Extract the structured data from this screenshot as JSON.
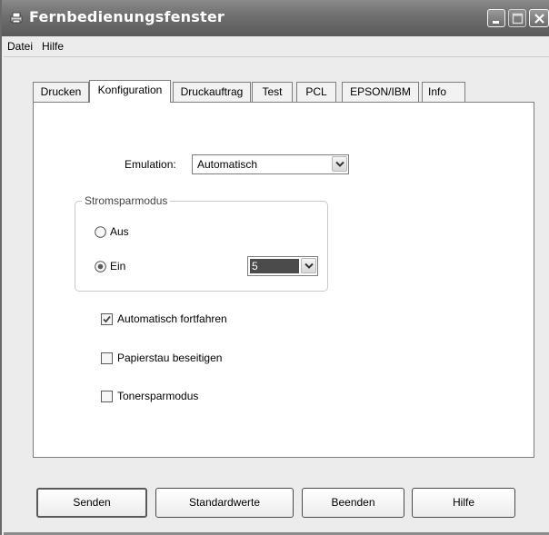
{
  "window": {
    "title": "Fernbedienungsfenster"
  },
  "menu": {
    "items": [
      "Datei",
      "Hilfe"
    ]
  },
  "tabs": [
    "Drucken",
    "Konfiguration",
    "Druckauftrag",
    "Test",
    "PCL",
    "EPSON/IBM",
    "Info"
  ],
  "active_tab": "Konfiguration",
  "emulation": {
    "label": "Emulation:",
    "value": "Automatisch"
  },
  "power_save": {
    "legend": "Stromsparmodus",
    "off_label": "Aus",
    "on_label": "Ein",
    "selected": "Ein",
    "minutes_value": "5"
  },
  "checkboxes": [
    {
      "label": "Automatisch fortfahren",
      "checked": true
    },
    {
      "label": "Papierstau beseitigen",
      "checked": false
    },
    {
      "label": "Tonersparmodus",
      "checked": false
    }
  ],
  "buttons": {
    "send": "Senden",
    "defaults": "Standardwerte",
    "exit": "Beenden",
    "help": "Hilfe"
  }
}
